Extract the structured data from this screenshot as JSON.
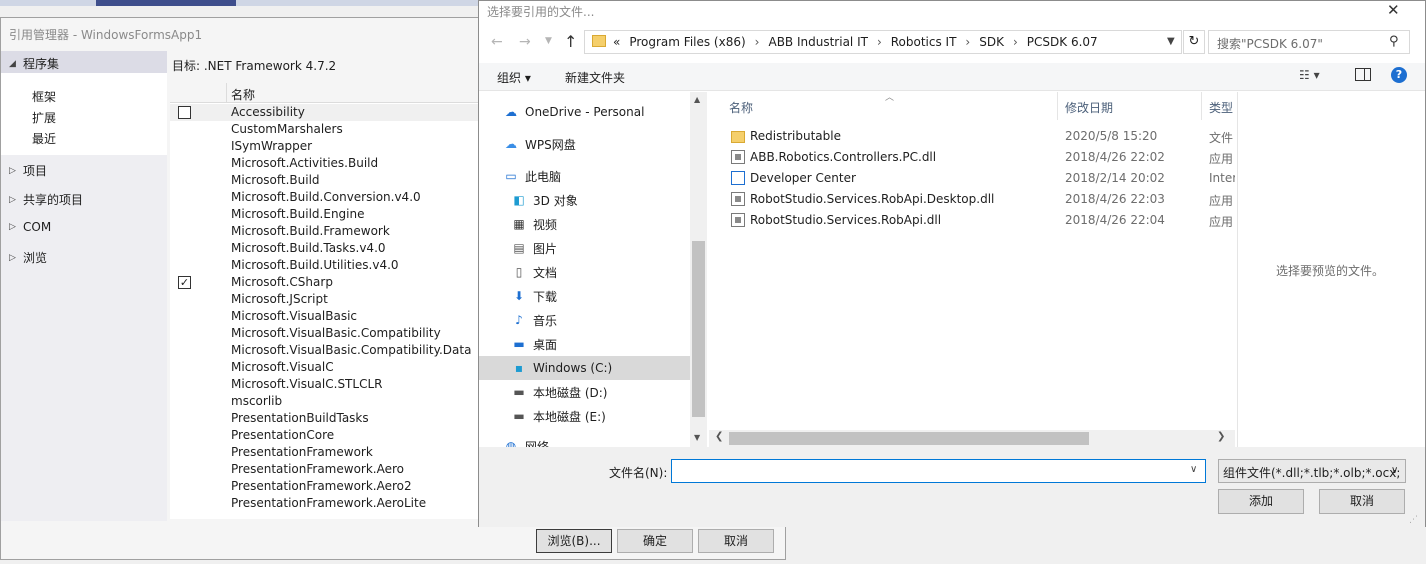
{
  "refmgr": {
    "title": "引用管理器 - WindowsFormsApp1",
    "nav": {
      "assemblies": "程序集",
      "sub": [
        "框架",
        "扩展",
        "最近"
      ],
      "projects": "项目",
      "shared_projects": "共享的项目",
      "com": "COM",
      "browse": "浏览"
    },
    "target": "目标: .NET Framework 4.7.2",
    "column_name": "名称",
    "assemblies": [
      {
        "name": "Accessibility",
        "checked": false,
        "show_cb": true
      },
      {
        "name": "CustomMarshalers"
      },
      {
        "name": "ISymWrapper"
      },
      {
        "name": "Microsoft.Activities.Build"
      },
      {
        "name": "Microsoft.Build"
      },
      {
        "name": "Microsoft.Build.Conversion.v4.0"
      },
      {
        "name": "Microsoft.Build.Engine"
      },
      {
        "name": "Microsoft.Build.Framework"
      },
      {
        "name": "Microsoft.Build.Tasks.v4.0"
      },
      {
        "name": "Microsoft.Build.Utilities.v4.0"
      },
      {
        "name": "Microsoft.CSharp",
        "checked": true,
        "show_cb": true
      },
      {
        "name": "Microsoft.JScript"
      },
      {
        "name": "Microsoft.VisualBasic"
      },
      {
        "name": "Microsoft.VisualBasic.Compatibility"
      },
      {
        "name": "Microsoft.VisualBasic.Compatibility.Data"
      },
      {
        "name": "Microsoft.VisualC"
      },
      {
        "name": "Microsoft.VisualC.STLCLR"
      },
      {
        "name": "mscorlib"
      },
      {
        "name": "PresentationBuildTasks"
      },
      {
        "name": "PresentationCore"
      },
      {
        "name": "PresentationFramework"
      },
      {
        "name": "PresentationFramework.Aero"
      },
      {
        "name": "PresentationFramework.Aero2"
      },
      {
        "name": "PresentationFramework.AeroLite"
      }
    ],
    "buttons": {
      "browse": "浏览(B)...",
      "ok": "确定",
      "cancel": "取消"
    }
  },
  "dialog": {
    "title": "选择要引用的文件...",
    "close": "✕",
    "address": {
      "prefix": "«",
      "crumbs": [
        "Program Files (x86)",
        "ABB Industrial IT",
        "Robotics IT",
        "SDK",
        "PCSDK 6.07"
      ]
    },
    "search_placeholder": "搜索\"PCSDK 6.07\"",
    "toolbar": {
      "organize": "组织 ▾",
      "new_folder": "新建文件夹"
    },
    "tree": [
      {
        "label": "OneDrive - Personal",
        "icon": "cloud-icon",
        "glyph": "☁",
        "color": "#1d6fd1"
      },
      {
        "label": "WPS网盘",
        "icon": "cloud-icon",
        "glyph": "☁",
        "color": "#3a8ee6"
      },
      {
        "label": "此电脑",
        "icon": "computer-icon",
        "glyph": "▭",
        "color": "#1d6fd1"
      },
      {
        "label": "3D 对象",
        "icon": "cube-icon",
        "glyph": "◧",
        "color": "#1d9bd1"
      },
      {
        "label": "视频",
        "icon": "video-icon",
        "glyph": "▦",
        "color": "#333"
      },
      {
        "label": "图片",
        "icon": "picture-icon",
        "glyph": "▤",
        "color": "#555"
      },
      {
        "label": "文档",
        "icon": "document-icon",
        "glyph": "▯",
        "color": "#555"
      },
      {
        "label": "下载",
        "icon": "download-icon",
        "glyph": "⬇",
        "color": "#1d6fd1"
      },
      {
        "label": "音乐",
        "icon": "music-icon",
        "glyph": "♪",
        "color": "#1d6fd1"
      },
      {
        "label": "桌面",
        "icon": "desktop-icon",
        "glyph": "▬",
        "color": "#1d6fd1"
      },
      {
        "label": "Windows (C:)",
        "icon": "drive-icon",
        "glyph": "▪",
        "color": "#1d9bd1"
      },
      {
        "label": "本地磁盘 (D:)",
        "icon": "drive-icon",
        "glyph": "▬",
        "color": "#555"
      },
      {
        "label": "本地磁盘 (E:)",
        "icon": "drive-icon",
        "glyph": "▬",
        "color": "#555"
      },
      {
        "label": "网络",
        "icon": "network-icon",
        "glyph": "◍",
        "color": "#1d6fd1"
      }
    ],
    "columns": {
      "name": "名称",
      "date": "修改日期",
      "type": "类型"
    },
    "files": [
      {
        "name": "Redistributable",
        "date": "2020/5/8 15:20",
        "type": "文件",
        "kind": "folder"
      },
      {
        "name": "ABB.Robotics.Controllers.PC.dll",
        "date": "2018/4/26 22:02",
        "type": "应用",
        "kind": "dll"
      },
      {
        "name": "Developer Center",
        "date": "2018/2/14 20:02",
        "type": "Inter",
        "kind": "link"
      },
      {
        "name": "RobotStudio.Services.RobApi.Desktop.dll",
        "date": "2018/4/26 22:03",
        "type": "应用",
        "kind": "dll"
      },
      {
        "name": "RobotStudio.Services.RobApi.dll",
        "date": "2018/4/26 22:04",
        "type": "应用",
        "kind": "dll"
      }
    ],
    "preview_text": "选择要预览的文件。",
    "filename_label": "文件名(N):",
    "filename_value": "",
    "filter": "组件文件(*.dll;*.tlb;*.olb;*.ocx;",
    "buttons": {
      "add": "添加",
      "cancel": "取消"
    }
  }
}
